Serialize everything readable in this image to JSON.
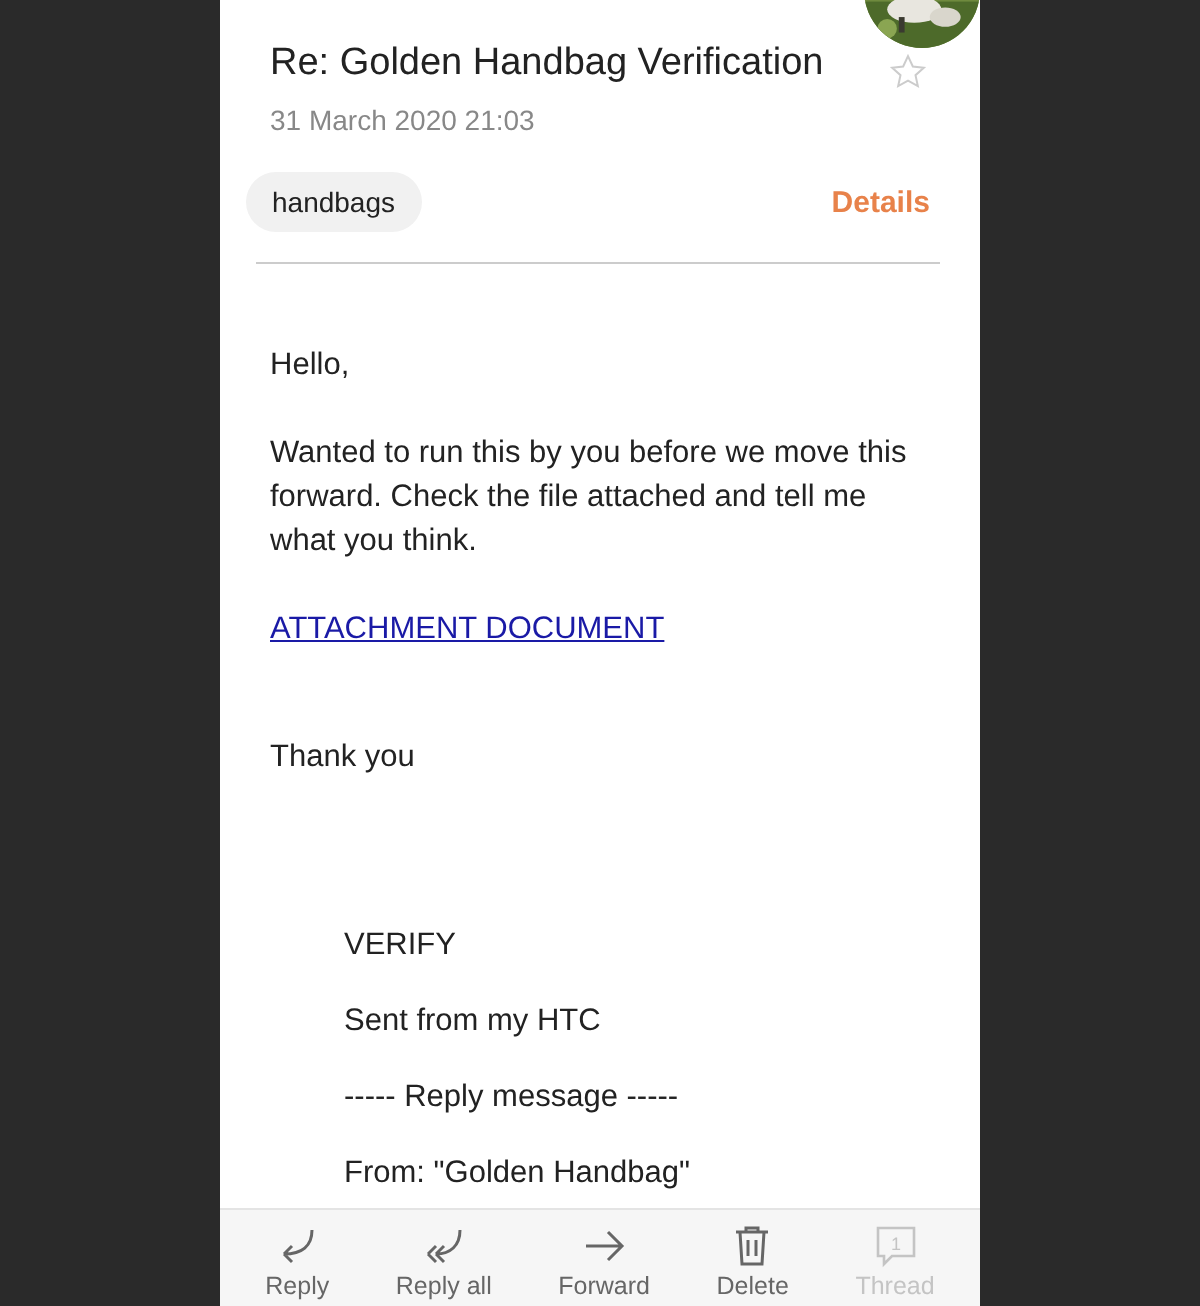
{
  "header": {
    "title": "Re: Golden Handbag Verification",
    "date": "31 March 2020  21:03",
    "starred": false
  },
  "tag": "handbags",
  "details_link": "Details",
  "body": {
    "greeting": "Hello,",
    "paragraph": "Wanted to run this by you before we move this forward. Check the file attached and tell me what you think.",
    "link": "ATTACHMENT DOCUMENT",
    "closing": "Thank you",
    "quoted": [
      "VERIFY",
      "Sent from my HTC",
      "----- Reply message -----",
      "From: \"Golden Handbag\""
    ]
  },
  "toolbar": [
    {
      "kind": "reply",
      "label": "Reply",
      "disabled": false
    },
    {
      "kind": "reply_all",
      "label": "Reply all",
      "disabled": false
    },
    {
      "kind": "forward",
      "label": "Forward",
      "disabled": false
    },
    {
      "kind": "delete",
      "label": "Delete",
      "disabled": false
    },
    {
      "kind": "thread",
      "label": "Thread",
      "badge": "1",
      "disabled": true
    }
  ]
}
